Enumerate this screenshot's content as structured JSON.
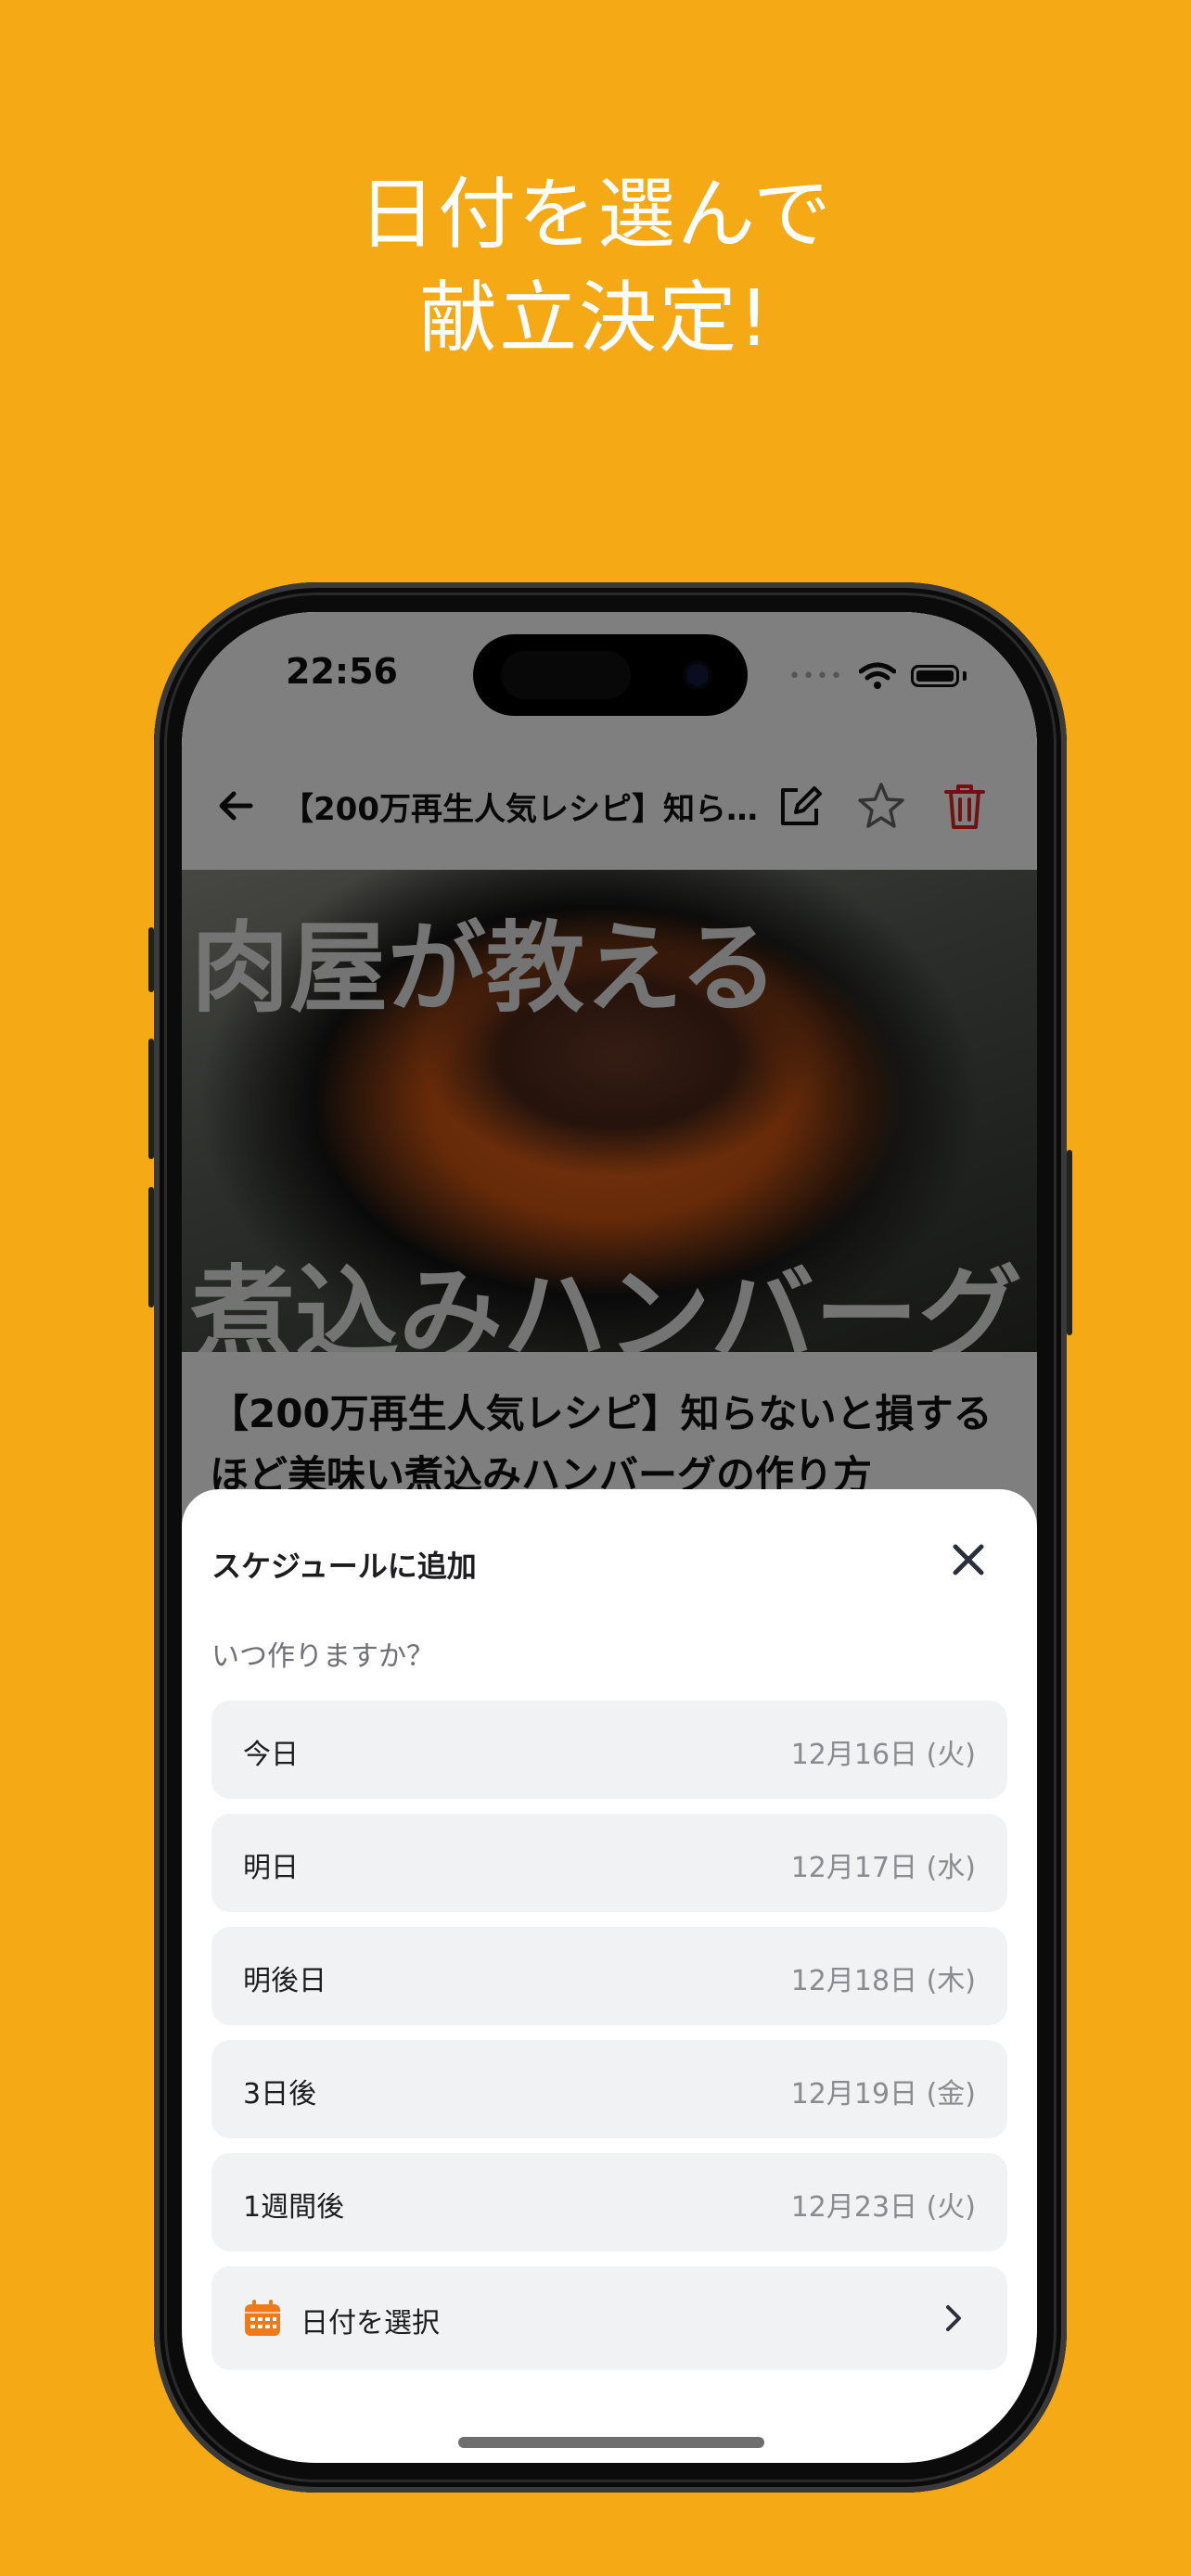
{
  "headline": {
    "line1": "日付を選んで",
    "line2": "献立決定!"
  },
  "status_bar": {
    "time": "22:56",
    "signal": "••••"
  },
  "top_bar": {
    "title": "【200万再生人気レシピ】知ら…"
  },
  "hero": {
    "line1": "肉屋が教える",
    "line2": "煮込みハンバーグ"
  },
  "recipe": {
    "title": "【200万再生人気レシピ】知らないと損するほど美味い煮込みハンバーグの作り方"
  },
  "sheet": {
    "title": "スケジュールに追加",
    "question": "いつ作りますか？",
    "options": [
      {
        "label": "今日",
        "date": "12月16日 (火)"
      },
      {
        "label": "明日",
        "date": "12月17日 (水)"
      },
      {
        "label": "明後日",
        "date": "12月18日 (木)"
      },
      {
        "label": "3日後",
        "date": "12月19日 (金)"
      },
      {
        "label": "1週間後",
        "date": "12月23日 (火)"
      }
    ],
    "pick_date_label": "日付を選択"
  },
  "colors": {
    "background": "#F5A914",
    "accent_orange": "#F07A1A",
    "delete_red": "#E02424"
  },
  "icons": [
    "back-arrow-icon",
    "edit-icon",
    "star-icon",
    "trash-icon",
    "close-icon",
    "calendar-icon",
    "chevron-right-icon"
  ]
}
